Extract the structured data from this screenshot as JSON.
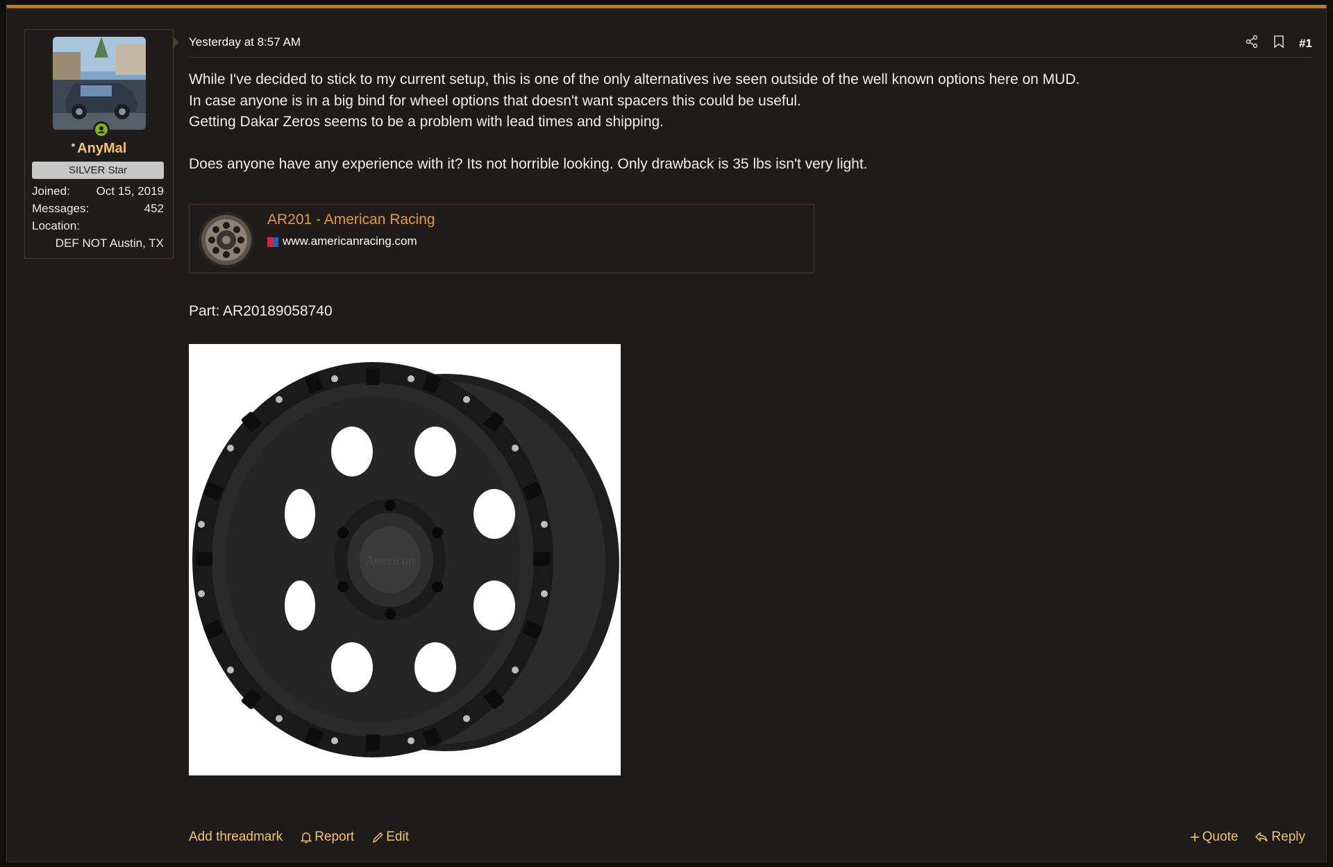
{
  "post": {
    "timestamp": "Yesterday at 8:57 AM",
    "number": "#1",
    "paragraphs": [
      "While I've decided to stick to my current setup, this is one of the only alternatives ive seen outside of the well known options here on MUD.",
      "In case anyone is in a big bind for wheel options that doesn't want spacers this could be useful.",
      "Getting Dakar Zeros seems to be a problem with lead times and shipping.",
      "Does anyone have any experience with it? Its not horrible looking. Only drawback is 35 lbs isn't very light."
    ],
    "part": "Part: AR20189058740"
  },
  "user": {
    "star": "*",
    "name": "AnyMal",
    "rank": "SILVER Star",
    "joined_label": "Joined:",
    "joined_value": "Oct 15, 2019",
    "messages_label": "Messages:",
    "messages_value": "452",
    "location_label": "Location:",
    "location_value": "DEF NOT Austin, TX"
  },
  "unfurl": {
    "title": "AR201 - American Racing",
    "domain": "www.americanracing.com"
  },
  "footer": {
    "threadmark": "Add threadmark",
    "report": "Report",
    "edit": "Edit",
    "quote": "Quote",
    "reply": "Reply"
  },
  "colors": {
    "accent_bar": "#c47a1c",
    "link": "#f3c470",
    "unfurl_title": "#e59a3d",
    "background": "#1e1b1a"
  },
  "icons": [
    "share-icon",
    "bookmark-icon",
    "bell-icon",
    "pencil-icon",
    "plus-icon",
    "reply-arrow-icon",
    "user-online-icon"
  ]
}
